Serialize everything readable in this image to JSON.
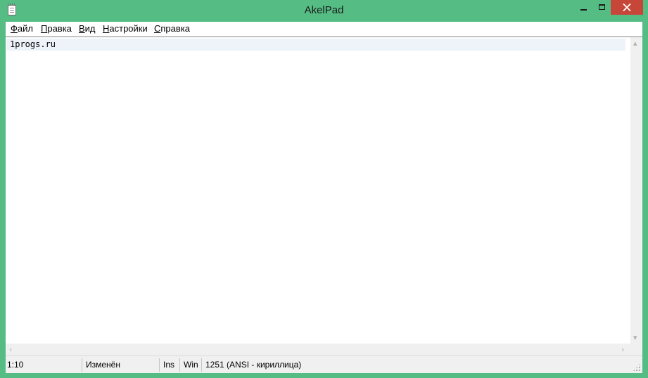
{
  "window": {
    "title": "AkelPad"
  },
  "menu": {
    "items": [
      {
        "underline": "Ф",
        "rest": "айл"
      },
      {
        "underline": "П",
        "rest": "равка"
      },
      {
        "underline": "В",
        "rest": "ид"
      },
      {
        "underline": "Н",
        "rest": "астройки"
      },
      {
        "underline": "С",
        "rest": "правка"
      }
    ]
  },
  "editor": {
    "text": "1progs.ru"
  },
  "statusbar": {
    "position": "1:10",
    "modified": "Изменён",
    "insert_mode": "Ins",
    "newline": "Win",
    "codepage": "1251  (ANSI - кириллица)"
  },
  "colors": {
    "frame": "#55bd84",
    "close_button": "#c7463a",
    "current_line": "#eef3fa"
  }
}
